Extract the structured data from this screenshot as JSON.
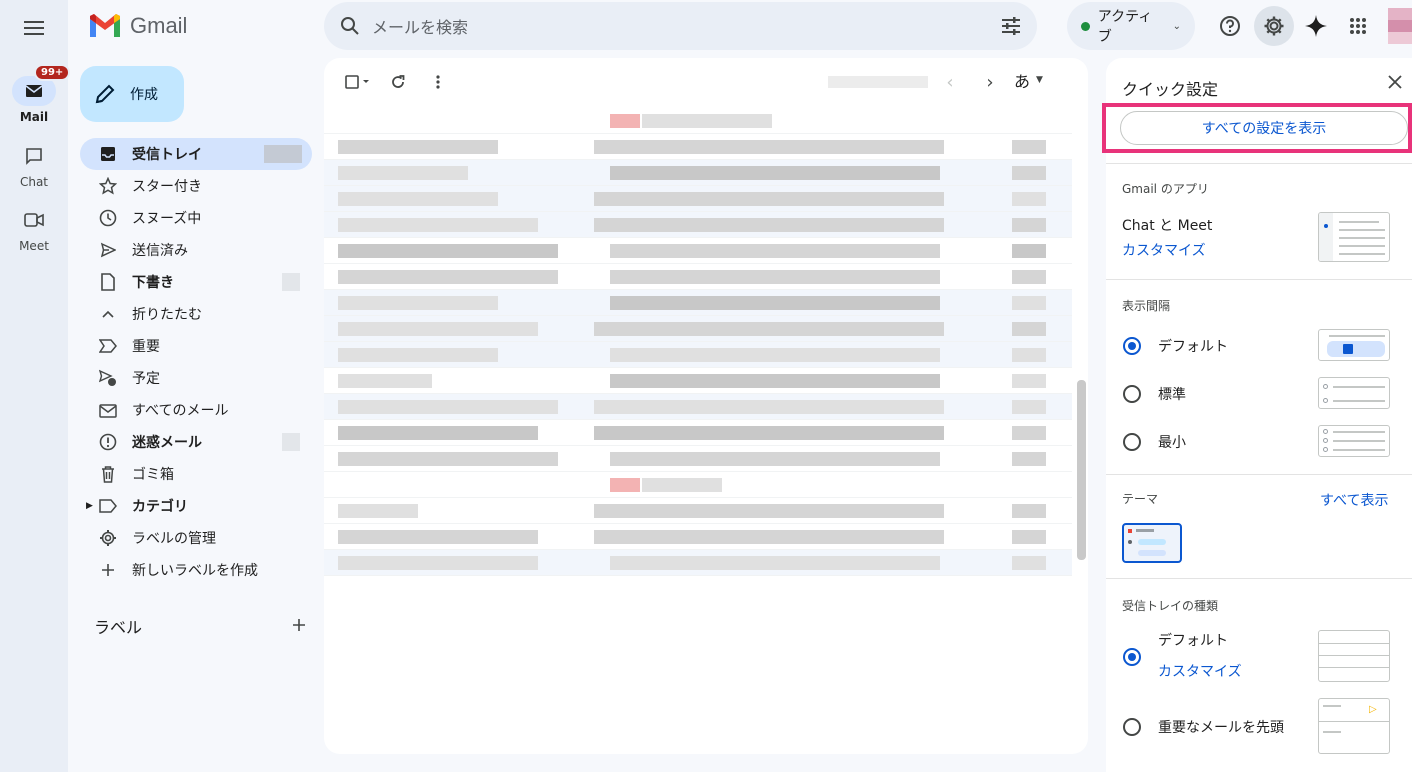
{
  "app": {
    "name": "Gmail"
  },
  "rail": [
    {
      "label": "Mail",
      "badge": "99+"
    },
    {
      "label": "Chat"
    },
    {
      "label": "Meet"
    }
  ],
  "search": {
    "placeholder": "メールを検索"
  },
  "status": {
    "label": "アクティブ",
    "color": "#1e8e3e"
  },
  "compose": {
    "label": "作成"
  },
  "nav": [
    {
      "label": "受信トレイ",
      "icon": "inbox-icon"
    },
    {
      "label": "スター付き",
      "icon": "star-icon"
    },
    {
      "label": "スヌーズ中",
      "icon": "clock-icon"
    },
    {
      "label": "送信済み",
      "icon": "send-icon"
    },
    {
      "label": "下書き",
      "icon": "file-icon"
    },
    {
      "label": "折りたたむ",
      "icon": "chevron-up-icon"
    },
    {
      "label": "重要",
      "icon": "important-icon"
    },
    {
      "label": "予定",
      "icon": "scheduled-icon"
    },
    {
      "label": "すべてのメール",
      "icon": "all-mail-icon"
    },
    {
      "label": "迷惑メール",
      "icon": "spam-icon"
    },
    {
      "label": "ゴミ箱",
      "icon": "trash-icon"
    },
    {
      "label": "カテゴリ",
      "icon": "label-icon"
    },
    {
      "label": "ラベルの管理",
      "icon": "gear-icon"
    },
    {
      "label": "新しいラベルを作成",
      "icon": "plus-icon"
    }
  ],
  "labels": {
    "title": "ラベル"
  },
  "toolbar": {
    "lang": "あ"
  },
  "quick_settings": {
    "title": "クイック設定",
    "all_settings": "すべての設定を表示",
    "apps": {
      "title": "Gmail のアプリ",
      "text": "Chat と Meet",
      "link": "カスタマイズ"
    },
    "density": {
      "title": "表示間隔",
      "options": [
        "デフォルト",
        "標準",
        "最小"
      ],
      "selected": "デフォルト"
    },
    "theme": {
      "title": "テーマ",
      "link": "すべて表示"
    },
    "inbox_type": {
      "title": "受信トレイの種類",
      "options": [
        "デフォルト",
        "重要なメールを先頭"
      ],
      "customize": "カスタマイズ",
      "selected": "デフォルト"
    }
  },
  "colors": {
    "accent": "#0b57d0",
    "highlight": "#e8337a",
    "compose": "#c2e7ff",
    "active_nav": "#d3e3fd"
  }
}
